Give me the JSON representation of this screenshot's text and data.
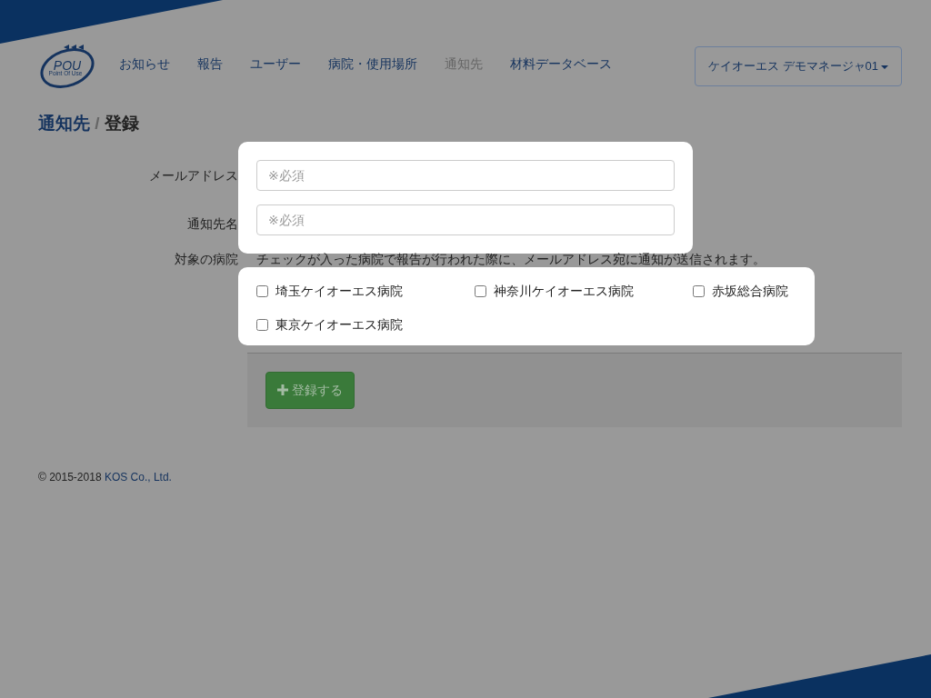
{
  "nav": {
    "logo": {
      "text": "POU",
      "subtitle": "Point Of Use"
    },
    "items": [
      {
        "label": "お知らせ",
        "selected": false
      },
      {
        "label": "報告",
        "selected": false
      },
      {
        "label": "ユーザー",
        "selected": false
      },
      {
        "label": "病院・使用場所",
        "selected": false
      },
      {
        "label": "通知先",
        "selected": true
      },
      {
        "label": "材料データベース",
        "selected": false
      }
    ],
    "user_menu": "ケイオーエス デモマネージャ01"
  },
  "breadcrumb": {
    "parent": "通知先",
    "separator": "/",
    "current": "登録"
  },
  "form": {
    "fields": [
      {
        "label": "メールアドレス",
        "placeholder": "※必須"
      },
      {
        "label": "通知先名",
        "placeholder": "※必須"
      }
    ],
    "hospitals_label": "対象の病院",
    "hospitals_note": "チェックが入った病院で報告が行われた際に、メールアドレス宛に通知が送信されます。",
    "hospitals": [
      {
        "name": "埼玉ケイオーエス病院",
        "checked": false
      },
      {
        "name": "神奈川ケイオーエス病院",
        "checked": false
      },
      {
        "name": "赤坂総合病院",
        "checked": false
      },
      {
        "name": "東京ケイオーエス病院",
        "checked": false
      }
    ],
    "submit": "登録する"
  },
  "footer": {
    "copyright": "© 2015-2018",
    "company": "KOS Co., Ltd."
  }
}
